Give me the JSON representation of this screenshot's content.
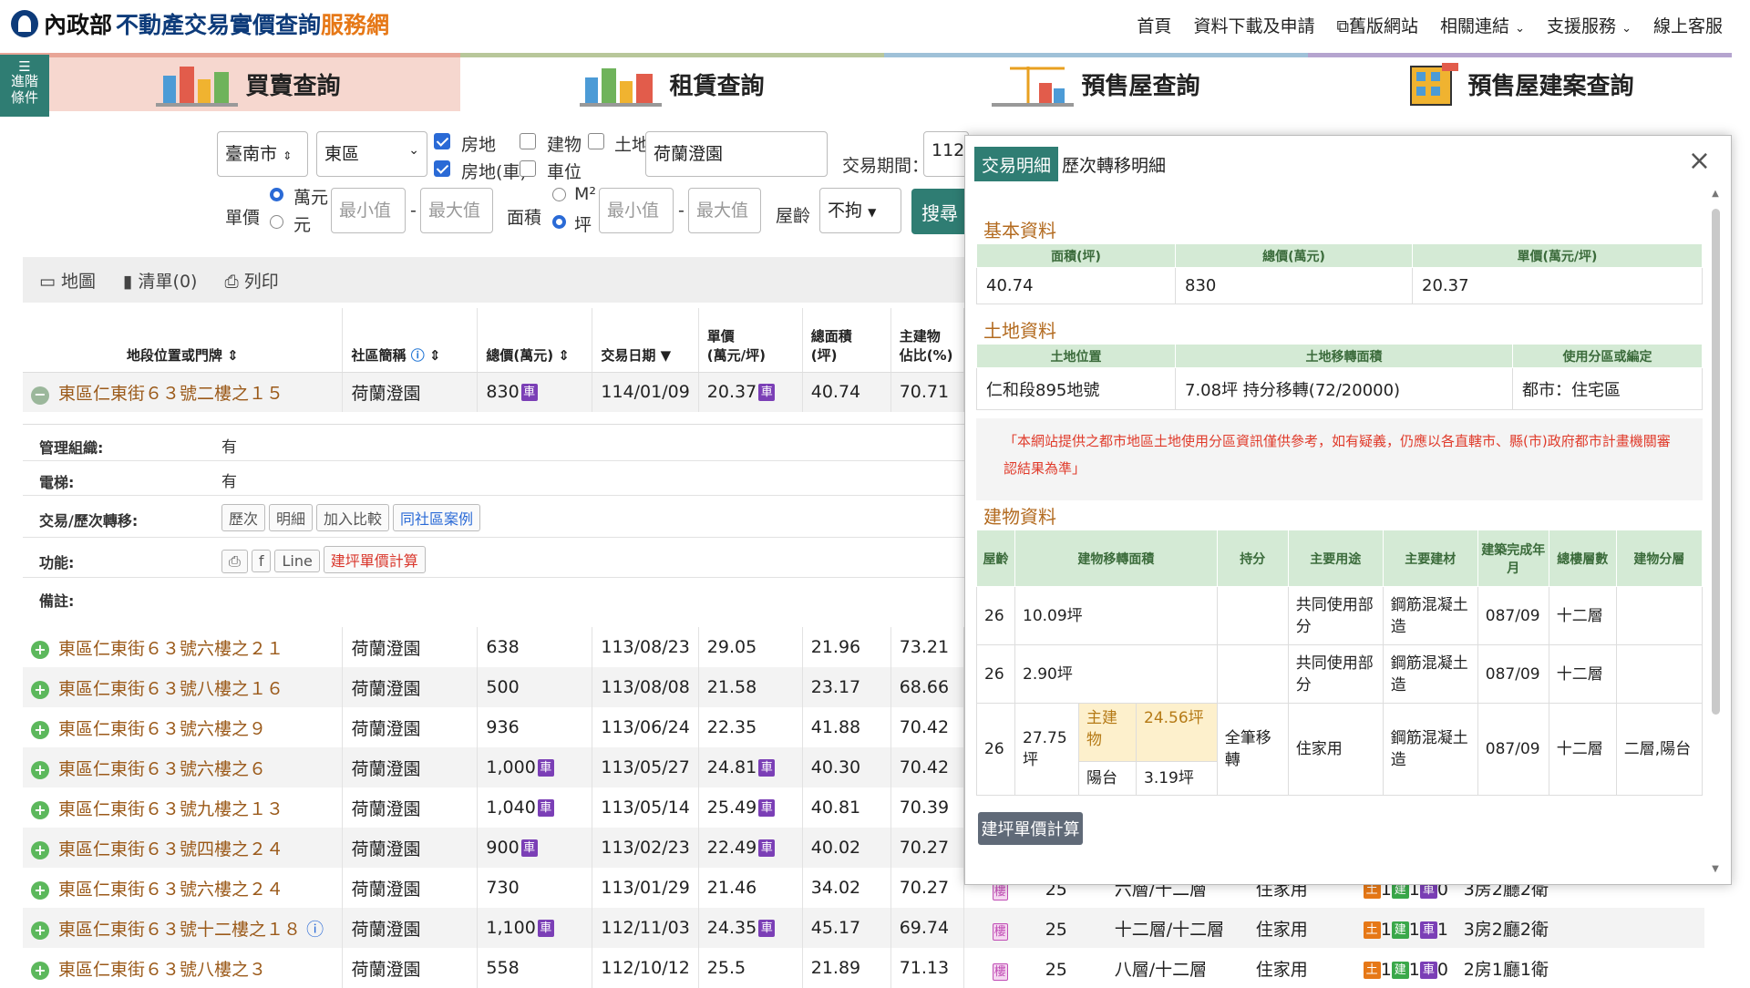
{
  "header": {
    "logo_moi": "內政部",
    "logo_main": "不動產交易實價查詢",
    "logo_sub": "服務網",
    "nav": [
      "首頁",
      "資料下載及申請",
      "舊版網站",
      "相關連結",
      "支援服務",
      "線上客服"
    ]
  },
  "sidebar": {
    "advanced_label": "進階\n條件"
  },
  "tabs": [
    {
      "label": "買賣查詢",
      "color": "#f4cfc6",
      "border": "#e8a597"
    },
    {
      "label": "租賃查詢",
      "color": "#ffffff",
      "border": "#b8c79a"
    },
    {
      "label": "預售屋查詢",
      "color": "#ffffff",
      "border": "#9fc1d8"
    },
    {
      "label": "預售屋建案查詢",
      "color": "#ffffff",
      "border": "#b5a4cf"
    }
  ],
  "query": {
    "city": "臺南市",
    "district": "東區",
    "opt_house": "房地",
    "opt_building": "建物",
    "opt_land": "土地",
    "opt_house_car": "房地(車)",
    "opt_car": "車位",
    "community": "荷蘭澄園",
    "period_label": "交易期間：",
    "period_value": "112",
    "price_label": "單價",
    "unit_wan": "萬元",
    "unit_yuan": "元",
    "min": "最小值",
    "max": "最大值",
    "area_label": "面積",
    "unit_m2": "M²",
    "unit_ping": "坪",
    "age_label": "屋齡",
    "age_value": "不拘",
    "search_btn": "搜尋"
  },
  "toolbar": {
    "map": "地圖",
    "list": "清單(0)",
    "print": "列印"
  },
  "columns": {
    "addr": "地段位置或門牌",
    "community": "社區簡稱",
    "total": "總價(萬元)",
    "date": "交易日期",
    "unit": "單價",
    "unit2": "(萬元/坪)",
    "area": "總面積",
    "area2": "(坪)",
    "ratio": "主建物",
    "ratio2": "佔比(%)"
  },
  "expanded_row": {
    "addr": "東區仁東街６３號二樓之１５",
    "community": "荷蘭澄園",
    "total": "830",
    "date": "114/01/09",
    "unit": "20.37",
    "area": "40.74",
    "ratio": "70.71"
  },
  "detail": {
    "mgmt_k": "管理組織:",
    "mgmt_v": "有",
    "elev_k": "電梯:",
    "elev_v": "有",
    "trans_k": "交易/歷次轉移:",
    "btn_hist": "歷次",
    "btn_detail": "明細",
    "btn_compare": "加入比較",
    "btn_same": "同社區案例",
    "func_k": "功能:",
    "line": "Line",
    "calc": "建坪單價計算",
    "remark_k": "備註:"
  },
  "rows": [
    {
      "addr": "東區仁東街６３號六樓之２１",
      "community": "荷蘭澄園",
      "total": "638",
      "car_t": false,
      "date": "113/08/23",
      "unit": "29.05",
      "car_u": false,
      "area": "21.96",
      "ratio": "73.21",
      "lou": "",
      "age": "",
      "floor": "",
      "use": "",
      "rooms": "",
      "b": [
        "",
        "",
        ""
      ]
    },
    {
      "addr": "東區仁東街６３號八樓之１６",
      "community": "荷蘭澄園",
      "total": "500",
      "car_t": false,
      "date": "113/08/08",
      "unit": "21.58",
      "car_u": false,
      "area": "23.17",
      "ratio": "68.66",
      "lou": "",
      "age": "",
      "floor": "",
      "use": "",
      "rooms": "",
      "b": [
        "",
        "",
        ""
      ]
    },
    {
      "addr": "東區仁東街６３號六樓之９",
      "community": "荷蘭澄園",
      "total": "936",
      "car_t": false,
      "date": "113/06/24",
      "unit": "22.35",
      "car_u": false,
      "area": "41.88",
      "ratio": "70.42",
      "lou": "",
      "age": "",
      "floor": "",
      "use": "",
      "rooms": "",
      "b": [
        "",
        "",
        ""
      ]
    },
    {
      "addr": "東區仁東街６３號六樓之６",
      "community": "荷蘭澄園",
      "total": "1,000",
      "car_t": true,
      "date": "113/05/27",
      "unit": "24.81",
      "car_u": true,
      "area": "40.30",
      "ratio": "70.42",
      "lou": "",
      "age": "",
      "floor": "",
      "use": "",
      "rooms": "",
      "b": [
        "",
        "",
        ""
      ]
    },
    {
      "addr": "東區仁東街６３號九樓之１３",
      "community": "荷蘭澄園",
      "total": "1,040",
      "car_t": true,
      "date": "113/05/14",
      "unit": "25.49",
      "car_u": true,
      "area": "40.81",
      "ratio": "70.39",
      "lou": "",
      "age": "",
      "floor": "",
      "use": "",
      "rooms": "",
      "b": [
        "",
        "",
        ""
      ]
    },
    {
      "addr": "東區仁東街６３號四樓之２４",
      "community": "荷蘭澄園",
      "total": "900",
      "car_t": true,
      "date": "113/02/23",
      "unit": "22.49",
      "car_u": true,
      "area": "40.02",
      "ratio": "70.27",
      "lou": "",
      "age": "",
      "floor": "",
      "use": "",
      "rooms": "",
      "b": [
        "",
        "",
        ""
      ]
    },
    {
      "addr": "東區仁東街６３號六樓之２４",
      "community": "荷蘭澄園",
      "total": "730",
      "car_t": false,
      "date": "113/01/29",
      "unit": "21.46",
      "car_u": false,
      "area": "34.02",
      "ratio": "70.27",
      "lou": "樓",
      "age": "25",
      "floor": "六層/十二層",
      "use": "住家用",
      "rooms": "3房2廳2衛",
      "b": [
        "1",
        "1",
        "0"
      ]
    },
    {
      "addr": "東區仁東街６３號十二樓之１８",
      "community": "荷蘭澄園",
      "total": "1,100",
      "car_t": true,
      "date": "112/11/03",
      "unit": "24.35",
      "car_u": true,
      "area": "45.17",
      "ratio": "69.74",
      "lou": "樓",
      "age": "25",
      "floor": "十二層/十二層",
      "use": "住家用",
      "rooms": "3房2廳2衛",
      "b": [
        "1",
        "1",
        "1"
      ]
    },
    {
      "addr": "東區仁東街６３號八樓之３",
      "community": "荷蘭澄園",
      "total": "558",
      "car_t": false,
      "date": "112/10/12",
      "unit": "25.5",
      "car_u": false,
      "area": "21.89",
      "ratio": "71.13",
      "lou": "樓",
      "age": "25",
      "floor": "八層/十二層",
      "use": "住家用",
      "rooms": "2房1廳1衛",
      "b": [
        "1",
        "1",
        "0"
      ]
    }
  ],
  "badges": {
    "car": "車",
    "earth": "土",
    "build": "建",
    "car2": "車"
  },
  "modal": {
    "tab1": "交易明細",
    "tab2": "歷次轉移明細",
    "close": "×",
    "basic_title": "基本資料",
    "basic_h": [
      "面積(坪)",
      "總價(萬元)",
      "單價(萬元/坪)"
    ],
    "basic_v": [
      "40.74",
      "830",
      "20.37"
    ],
    "land_title": "土地資料",
    "land_h": [
      "土地位置",
      "土地移轉面積",
      "使用分區或編定"
    ],
    "land_v": [
      "仁和段895地號",
      "7.08坪 持分移轉(72/20000)",
      "都市：住宅區"
    ],
    "note": "「本網站提供之都市地區土地使用分區資訊僅供參考，如有疑義，仍應以各直轄市、縣(市)政府都市計畫機關審認結果為準」",
    "bld_title": "建物資料",
    "bld_h": {
      "age": "屋齡",
      "area": "建物移轉面積",
      "share": "持分",
      "use": "主要用途",
      "mat": "主要建材",
      "built": "建築完成年月",
      "floors": "總樓層數",
      "layer": "建物分層"
    },
    "bld_rows": [
      {
        "age": "26",
        "area": "10.09坪",
        "use": "共同使用部分",
        "mat": "鋼筋混凝土造",
        "built": "087/09",
        "floors": "十二層"
      },
      {
        "age": "26",
        "area": "2.90坪",
        "use": "共同使用部分",
        "mat": "鋼筋混凝土造",
        "built": "087/09",
        "floors": "十二層"
      }
    ],
    "bld_main": {
      "age": "26",
      "area": "27.75坪",
      "main_k": "主建物",
      "main_v": "24.56坪",
      "bal_k": "陽台",
      "bal_v": "3.19坪",
      "share": "全筆移轉",
      "use": "住家用",
      "mat": "鋼筋混凝土造",
      "built": "087/09",
      "floors": "十二層",
      "layer": "二層,陽台"
    },
    "calc_btn": "建坪單價計算"
  }
}
